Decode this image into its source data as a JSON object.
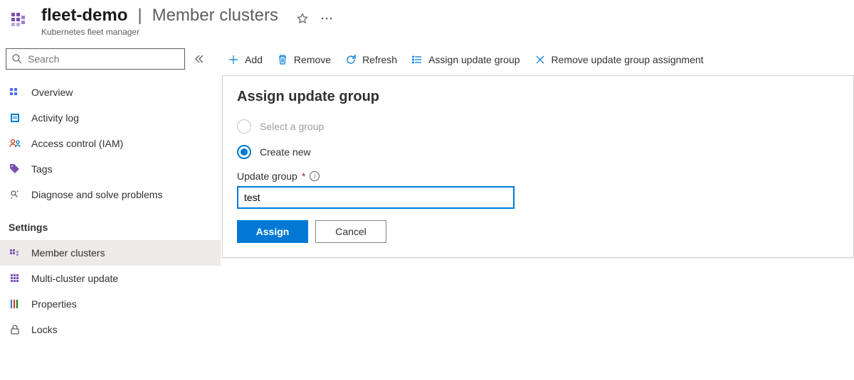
{
  "header": {
    "resource_name": "fleet-demo",
    "page_name": "Member clusters",
    "subtitle": "Kubernetes fleet manager"
  },
  "sidebar": {
    "search_placeholder": "Search",
    "section_settings": "Settings",
    "items_top": [
      {
        "label": "Overview"
      },
      {
        "label": "Activity log"
      },
      {
        "label": "Access control (IAM)"
      },
      {
        "label": "Tags"
      },
      {
        "label": "Diagnose and solve problems"
      }
    ],
    "items_settings": [
      {
        "label": "Member clusters"
      },
      {
        "label": "Multi-cluster update"
      },
      {
        "label": "Properties"
      },
      {
        "label": "Locks"
      }
    ]
  },
  "toolbar": {
    "add": "Add",
    "remove": "Remove",
    "refresh": "Refresh",
    "assign_group": "Assign update group",
    "remove_assignment": "Remove update group assignment"
  },
  "panel": {
    "title": "Assign update group",
    "radio_select": "Select a group",
    "radio_create": "Create new",
    "field_label": "Update group",
    "input_value": "test",
    "btn_assign": "Assign",
    "btn_cancel": "Cancel"
  }
}
